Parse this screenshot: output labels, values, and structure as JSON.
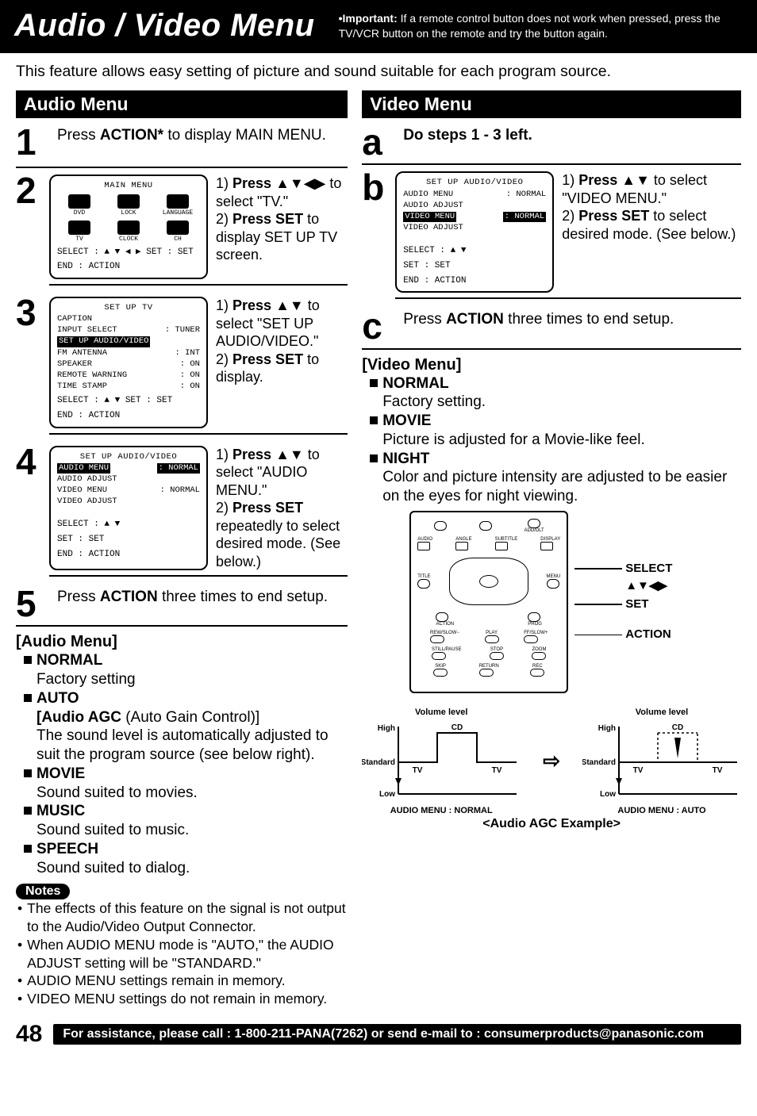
{
  "header": {
    "title": "Audio / Video Menu",
    "important_label": "•Important:",
    "important_text": "If a remote control button does not work when pressed, press the TV/VCR button on the remote and try the button again."
  },
  "intro": "This feature allows easy setting of picture and sound suitable for each program source.",
  "audio": {
    "section": "Audio Menu",
    "step1": {
      "num": "1",
      "text_pre": "Press ",
      "bold": "ACTION*",
      "text_post": " to display MAIN MENU."
    },
    "step2": {
      "num": "2",
      "screen": {
        "title": "MAIN MENU",
        "cells": [
          "DVD",
          "LOCK",
          "LANGUAGE",
          "TV",
          "CLOCK",
          "CH"
        ],
        "k1": "SELECT : ▲ ▼ ◀ ▶    SET : SET",
        "k2": "END        : ACTION"
      },
      "line1": "1) Press ▲▼◀▶ to select \"TV.\"",
      "line2": "2) Press SET to display SET UP TV screen."
    },
    "step3": {
      "num": "3",
      "screen": {
        "title": "SET UP TV",
        "rows": [
          [
            "CAPTION",
            ""
          ],
          [
            "INPUT SELECT",
            ": TUNER"
          ],
          [
            "SET UP AUDIO/VIDEO",
            ""
          ],
          [
            "FM ANTENNA",
            ": INT"
          ],
          [
            "SPEAKER",
            ": ON"
          ],
          [
            "REMOTE WARNING",
            ": ON"
          ],
          [
            "TIME STAMP",
            ": ON"
          ]
        ],
        "highlight_idx": 2,
        "k1": "SELECT : ▲ ▼          SET : SET",
        "k2": "END        : ACTION"
      },
      "line1": "1) Press ▲▼ to select \"SET UP AUDIO/VIDEO.\"",
      "line2": "2) Press SET to display."
    },
    "step4": {
      "num": "4",
      "screen": {
        "title": "SET UP AUDIO/VIDEO",
        "rows": [
          [
            "AUDIO MENU",
            ": NORMAL"
          ],
          [
            "AUDIO ADJUST",
            ""
          ],
          [
            "VIDEO MENU",
            ": NORMAL"
          ],
          [
            "VIDEO ADJUST",
            ""
          ]
        ],
        "highlight_idx": 0,
        "k1": "SELECT : ▲ ▼",
        "k2": "SET        : SET",
        "k3": "END        : ACTION"
      },
      "line1": "1) Press ▲▼ to select \"AUDIO MENU.\"",
      "line2": "2) Press SET repeatedly to select desired mode. (See below.)"
    },
    "step5": {
      "num": "5",
      "text": "Press ACTION three times to end setup."
    },
    "menu_title": "[Audio Menu]",
    "items": [
      {
        "label": "NORMAL",
        "desc": "Factory setting"
      },
      {
        "label": "AUTO",
        "desc_bold": "[Audio AGC",
        "desc_gain": " (Auto Gain Control)]",
        "desc": "The sound level is automatically adjusted to suit the program source (see below right)."
      },
      {
        "label": "MOVIE",
        "desc": "Sound suited to movies."
      },
      {
        "label": "MUSIC",
        "desc": "Sound suited to music."
      },
      {
        "label": "SPEECH",
        "desc": "Sound suited to dialog."
      }
    ],
    "notes_label": "Notes",
    "notes": [
      "The effects of this feature on the signal is not output to the Audio/Video Output Connector.",
      "When AUDIO MENU mode is \"AUTO,\" the AUDIO ADJUST setting will be \"STANDARD.\"",
      "AUDIO MENU settings remain in memory.",
      "VIDEO MENU settings do not remain in memory."
    ]
  },
  "video": {
    "section": "Video Menu",
    "stepA": {
      "num": "a",
      "text": "Do steps 1 - 3 left."
    },
    "stepB": {
      "num": "b",
      "screen": {
        "title": "SET UP AUDIO/VIDEO",
        "rows": [
          [
            "AUDIO MENU",
            ": NORMAL"
          ],
          [
            "AUDIO ADJUST",
            ""
          ],
          [
            "VIDEO MENU",
            ": NORMAL"
          ],
          [
            "VIDEO ADJUST",
            ""
          ]
        ],
        "highlight_idx": 2,
        "k1": "SELECT : ▲ ▼",
        "k2": "SET        : SET",
        "k3": "END        : ACTION"
      },
      "line1": "1) Press ▲▼ to select \"VIDEO MENU.\"",
      "line2": "2) Press SET to select desired mode. (See below.)"
    },
    "stepC": {
      "num": "c",
      "text": "Press ACTION three times to end setup."
    },
    "menu_title": "[Video Menu]",
    "items": [
      {
        "label": "NORMAL",
        "desc": "Factory setting."
      },
      {
        "label": "MOVIE",
        "desc": "Picture is adjusted for a Movie-like feel."
      },
      {
        "label": "NIGHT",
        "desc": "Color and picture intensity are adjusted to be easier on the eyes for night viewing."
      }
    ],
    "remote_labels": {
      "select": "SELECT",
      "arrows": "▲▼◀▶",
      "set": "SET",
      "action": "ACTION"
    },
    "remote_text": {
      "audio": "AUDIO",
      "angle": "ANGLE",
      "sub": "SUBTITLE",
      "disp": "DISPLAY",
      "title": "TITLE",
      "menu": "MENU",
      "action_l": "ACTION",
      "prog": "PROG",
      "rew": "REW/SLOW−",
      "play": "PLAY",
      "ff": "FF/SLOW+",
      "still": "STILL/PAUSE",
      "stop": "STOP",
      "zoom": "ZOOM",
      "skip": "SKIP",
      "ret": "RETURN",
      "rec": "REC"
    },
    "agc": {
      "vol_label": "Volume level",
      "y_hi": "High",
      "y_std": "Standard",
      "y_lo": "Low",
      "cd": "CD",
      "tv": "TV",
      "cap_l": "AUDIO MENU : NORMAL",
      "cap_r": "AUDIO MENU : AUTO",
      "example": "<Audio AGC Example>"
    }
  },
  "chart_data": [
    {
      "type": "line",
      "title": "AUDIO MENU : NORMAL",
      "xlabel": "",
      "ylabel": "Volume level",
      "y_categories": [
        "Low",
        "Standard",
        "High"
      ],
      "segments": [
        "TV",
        "CD",
        "TV"
      ],
      "series": [
        {
          "name": "level",
          "values_by_segment": [
            "Standard",
            "High",
            "Standard"
          ]
        }
      ]
    },
    {
      "type": "line",
      "title": "AUDIO MENU : AUTO",
      "xlabel": "",
      "ylabel": "Volume level",
      "y_categories": [
        "Low",
        "Standard",
        "High"
      ],
      "segments": [
        "TV",
        "CD",
        "TV"
      ],
      "series": [
        {
          "name": "level",
          "values_by_segment": [
            "Standard",
            "Standard",
            "Standard"
          ]
        }
      ],
      "annotation": "CD peak suppressed toward Standard"
    }
  ],
  "footer": {
    "page": "48",
    "bar": "For assistance, please call : 1-800-211-PANA(7262) or send e-mail to : consumerproducts@panasonic.com"
  }
}
